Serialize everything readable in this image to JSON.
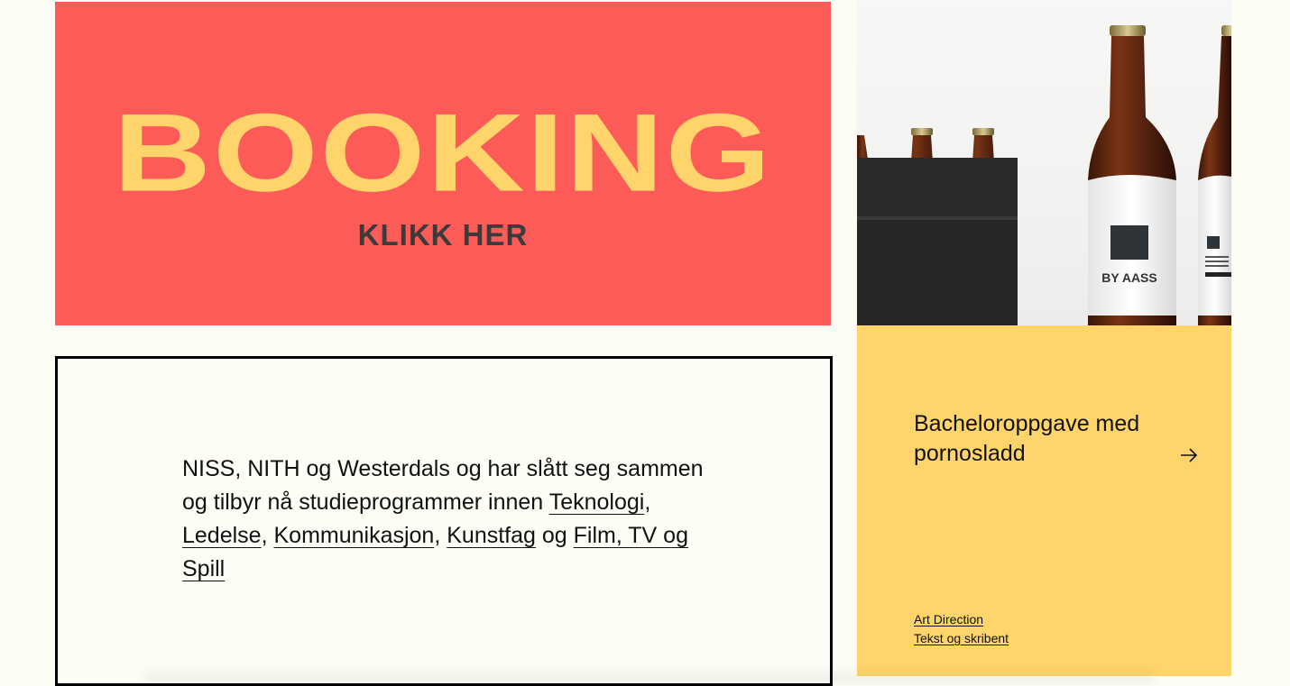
{
  "booking": {
    "title": "BOOKING",
    "subtitle": "KLIKK HER",
    "background_color": "#fd5b57",
    "title_color": "#fed46b"
  },
  "photo": {
    "label_text": "BY AASS"
  },
  "info": {
    "intro": "NISS, NITH og Westerdals og har slått seg sammen og tilbyr nå studieprogrammer innen",
    "links": [
      "Teknologi",
      "Ledelse",
      "Kommunikasjon",
      "Kunstfag"
    ],
    "separator": ", ",
    "conjunction": " og ",
    "last_link": "Film, TV og Spill"
  },
  "card": {
    "title": "Bacheloroppgave med pornosladd",
    "arrow_icon": "arrow-right-icon",
    "tags": [
      "Art Direction",
      "Tekst og skribent"
    ],
    "background_color": "#fed46b"
  }
}
